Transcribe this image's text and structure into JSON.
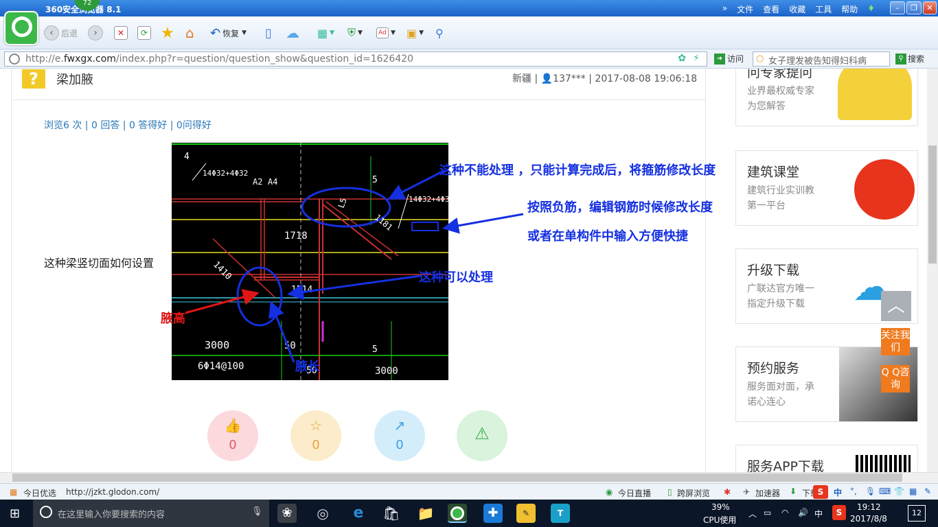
{
  "browser": {
    "title": "360安全浏览器 8.1",
    "badge": "72",
    "menu": [
      "文件",
      "查看",
      "收藏",
      "工具",
      "帮助"
    ],
    "back_label": "后退",
    "restore_label": "恢复",
    "url_prefix": "http://e.",
    "url_domain": "fwxgx.com",
    "url_rest": "/index.php?r=question/question_show&question_id=1626420",
    "visit_label": "访问",
    "search_placeholder": "女子理发被告知得妇科病",
    "search_label": "搜索"
  },
  "question": {
    "title": "梁加腋",
    "region": "新疆",
    "user": "137***",
    "time": "2017-08-08 19:06:18",
    "stats": "浏览6 次 | 0 回答 | 0 答得好 | 0问得好",
    "body": "这种梁竖切面如何设置",
    "image_annotations": {
      "a1": "这种不能处理 ，只能计算完成后，将箍筋修改长度",
      "a2": "按照负筋，编辑钢筋时候修改长度",
      "a3": "或者在单构件中输入方便快捷",
      "a4": "这种可以处理",
      "a5": "腋高",
      "a6": "腋长"
    },
    "cad_labels": [
      "4",
      "14Φ32+4Φ32",
      "A2",
      "A4",
      "5",
      "14Φ32+4Φ3",
      "1718",
      "1410",
      "1514",
      "3000",
      "6Φ14@100",
      "50",
      "5",
      "3000",
      "50",
      "L5",
      "1181"
    ],
    "actions": [
      {
        "icon": "thumb-up",
        "count": "0",
        "color": "#fbd9dd",
        "text": "#e05a6a"
      },
      {
        "icon": "star",
        "count": "0",
        "color": "#fdeccb",
        "text": "#e6a23c"
      },
      {
        "icon": "share",
        "count": "0",
        "color": "#d4edfb",
        "text": "#3a9ee0"
      },
      {
        "icon": "warning",
        "count": "",
        "color": "#d9f3dc",
        "text": "#3bae4d"
      }
    ]
  },
  "sidebar": [
    {
      "title": "问专家提问",
      "desc": [
        "业界最权威专家",
        "为您解答"
      ]
    },
    {
      "title": "建筑课堂",
      "desc": [
        "建筑行业实训教",
        "第一平台"
      ]
    },
    {
      "title": "升级下载",
      "desc": [
        "广联达官方唯一",
        "指定升级下载"
      ]
    },
    {
      "title": "预约服务",
      "desc": [
        "服务面对面，承",
        "诺心连心"
      ]
    },
    {
      "title": "服务APP下载",
      "desc": []
    }
  ],
  "float": {
    "follow": "关注我们",
    "qq": "Q Q咨询"
  },
  "status": {
    "left": "今日优选",
    "url": "http://jzkt.glodon.com/",
    "items": [
      "今日直播",
      "跨屏浏览",
      "加速器",
      "下载"
    ]
  },
  "taskbar": {
    "search": "在这里输入你要搜索的内容",
    "cpu": "39%",
    "cpu_label": "CPU使用",
    "ime": "中",
    "time": "19:12",
    "date": "2017/8/8",
    "notif": "12"
  }
}
